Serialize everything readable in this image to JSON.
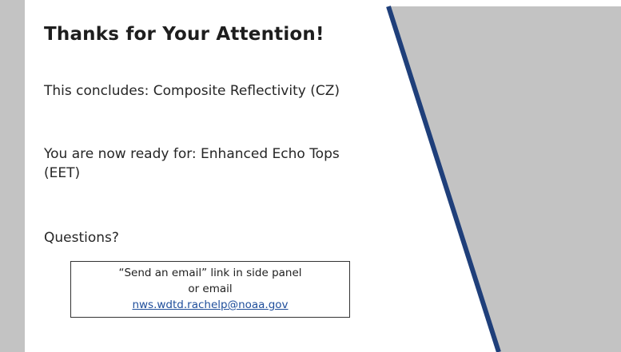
{
  "slide": {
    "title": "Thanks for Your Attention!",
    "concludes": "This concludes: Composite Reflectivity (CZ)",
    "ready": "You are now ready for: Enhanced Echo Tops (EET)",
    "questions": "Questions?",
    "contact": {
      "line1": "“Send an email” link in side panel",
      "line2": "or email",
      "email": "nws.wdtd.rachelp@noaa.gov"
    }
  },
  "colors": {
    "accent_stripe": "#1f3f7a",
    "side_panel": "#c3c3c3",
    "background": "#ffffff"
  }
}
